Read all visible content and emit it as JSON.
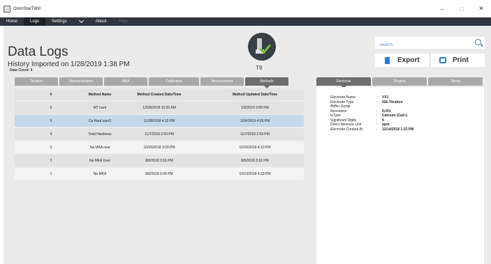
{
  "window": {
    "title": "OrionStarT900",
    "controls": {
      "minimize": "–",
      "maximize": "□",
      "close": "✕"
    }
  },
  "menu": {
    "items": [
      "Home",
      "Logs",
      "Settings",
      "About",
      "Help"
    ],
    "active": "Logs"
  },
  "header": {
    "title": "Data Logs",
    "subtitle": "History Imported on 1/28/2019 1:38 PM",
    "count_label": "Data Count:",
    "count_value": "6"
  },
  "device": {
    "name": "T9",
    "icon": "meter-probe-check-icon"
  },
  "search": {
    "placeholder": "Search"
  },
  "actions": {
    "export_label": "Export",
    "print_label": "Print"
  },
  "log_tabs": [
    "Titration",
    "Standardization",
    "MKA",
    "Calibration",
    "Measurement",
    "Methods"
  ],
  "active_log_tab": "Methods",
  "table": {
    "columns": [
      "#",
      "Method Name",
      "Method Created Date/Time",
      "Method Updated Date/Time"
    ],
    "rows": [
      {
        "num": "6",
        "name": "MT hard",
        "created": "12/28/2018 10:20 AM",
        "updated": "1/8/2019 3:58 PM"
      },
      {
        "num": "5",
        "name": "Ca Hard user2",
        "created": "11/28/2018 4:12 PM",
        "updated": "1/24/2019 4:39 PM"
      },
      {
        "num": "4",
        "name": "Total Hardness",
        "created": "11/7/2018 2:53 PM",
        "updated": "11/7/2018 2:53 PM"
      },
      {
        "num": "3",
        "name": "Na MKA new",
        "created": "10/26/2018 3:03 PM",
        "updated": "10/26/2018 4:10 PM"
      },
      {
        "num": "2",
        "name": "Na MKA User",
        "created": "8/8/2018 3:16 PM",
        "updated": "8/8/2018 3:16 PM"
      },
      {
        "num": "1",
        "name": "Na MKA",
        "created": "8/6/2018 6:49 PM",
        "updated": "10/23/2018 4:29 PM"
      }
    ],
    "selected_row_num": "5"
  },
  "detail_tabs": [
    "Electrode",
    "Titration",
    "Titrant"
  ],
  "active_detail_tab": "Electrode",
  "details": [
    {
      "label": "Electrode Name",
      "value": "VX1"
    },
    {
      "label": "Electrode Type",
      "value": "ISE-Titration"
    },
    {
      "label": "Buffer Group",
      "value": ""
    },
    {
      "label": "Resolution",
      "value": "0.001"
    },
    {
      "label": "IsType",
      "value": "Calcium (Ca2+)"
    },
    {
      "label": "Significant Digits",
      "value": "4"
    },
    {
      "label": "Direct Measure Unit",
      "value": "ppm"
    },
    {
      "label": "Electrode Created At",
      "value": "12/14/2018 1:23 PM"
    }
  ],
  "colors": {
    "menubar": "#2f363d",
    "accent": "#2f7bd6",
    "selected_row": "#c4d8ea",
    "active_tab": "#6e6e6e",
    "inactive_tab": "#a9a9a9",
    "check": "#6dbf3d"
  }
}
